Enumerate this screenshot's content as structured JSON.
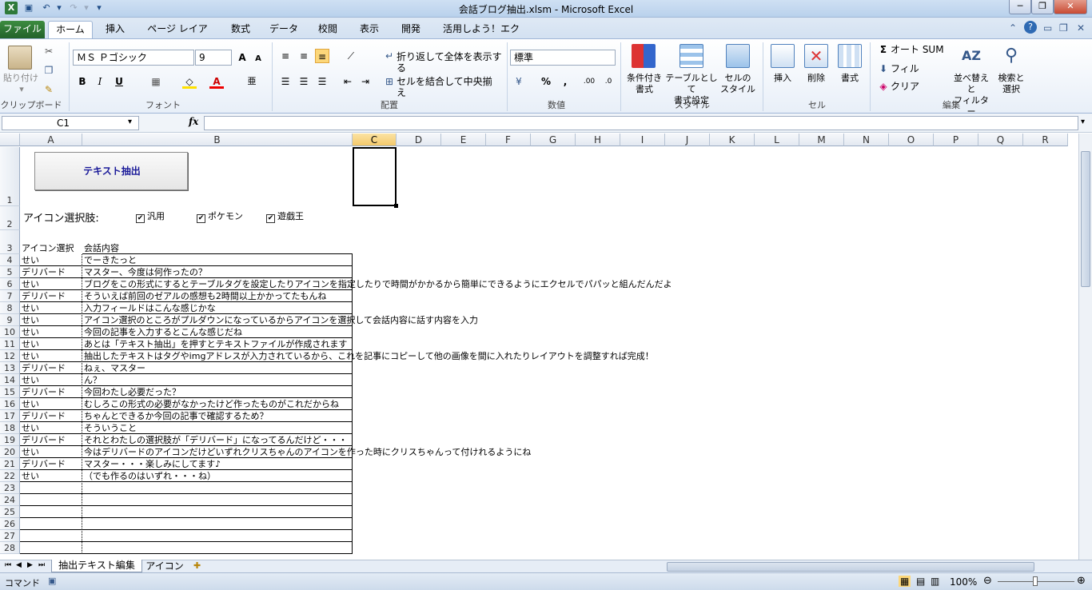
{
  "window": {
    "title": "会話ブログ抽出.xlsm - Microsoft Excel",
    "minimize": "─",
    "maximize": "❐",
    "close": "✕"
  },
  "quick_access": {
    "save_icon": "save-icon",
    "undo_icon": "undo-icon",
    "redo_icon": "redo-icon"
  },
  "tabs": [
    "ファイル",
    "ホーム",
    "挿入",
    "ページ レイアウト",
    "数式",
    "データ",
    "校閲",
    "表示",
    "開発",
    "活用しよう！エクセル"
  ],
  "ribbon": {
    "clipboard": {
      "paste": "貼り付け",
      "group": "クリップボード"
    },
    "font": {
      "name": "ＭＳ Ｐゴシック",
      "size": "9",
      "bold": "B",
      "italic": "I",
      "underline": "U",
      "group": "フォント",
      "grow": "A",
      "shrink": "A"
    },
    "alignment": {
      "wrap": "折り返して全体を表示する",
      "merge": "セルを結合して中央揃え",
      "group": "配置"
    },
    "number": {
      "format": "標準",
      "percent": "%",
      "comma": ",",
      "group": "数値"
    },
    "styles": {
      "conditional": "条件付き\n書式",
      "table": "テーブルとして\n書式設定",
      "cell": "セルの\nスタイル",
      "group": "スタイル"
    },
    "cells": {
      "insert": "挿入",
      "delete": "削除",
      "format": "書式",
      "group": "セル"
    },
    "editing": {
      "autosum": "オート SUM",
      "fill": "フィル",
      "clear": "クリア",
      "sort": "並べ替えと\nフィルター",
      "find": "検索と\n選択",
      "group": "編集"
    }
  },
  "formula_bar": {
    "namebox": "C1",
    "fx": "fx",
    "value": ""
  },
  "columns": [
    "A",
    "B",
    "C",
    "D",
    "E",
    "F",
    "G",
    "H",
    "I",
    "J",
    "K",
    "L",
    "M",
    "N",
    "O",
    "P",
    "Q",
    "R"
  ],
  "sheet": {
    "button": "テキスト抽出",
    "icon_label": "アイコン選択肢:",
    "checkboxes": [
      {
        "label": "汎用",
        "checked": true
      },
      {
        "label": "ポケモン",
        "checked": true
      },
      {
        "label": "遊戯王",
        "checked": true
      }
    ],
    "header_a": "アイコン選択",
    "header_b": "会話内容",
    "rows": [
      {
        "n": "4",
        "a": "せい",
        "b": "でーきたっと"
      },
      {
        "n": "5",
        "a": "デリバード",
        "b": "マスター、今度は何作ったの？"
      },
      {
        "n": "6",
        "a": "せい",
        "b": "ブログをこの形式にするとテーブルタグを設定したりアイコンを指定したりで時間がかかるから簡単にできるようにエクセルでパパッと組んだんだよ"
      },
      {
        "n": "7",
        "a": "デリバード",
        "b": "そういえば前回のゼアルの感想も2時間以上かかってたもんね"
      },
      {
        "n": "8",
        "a": "せい",
        "b": "入力フィールドはこんな感じかな"
      },
      {
        "n": "9",
        "a": "せい",
        "b": "アイコン選択のところがプルダウンになっているからアイコンを選択して会話内容に話す内容を入力"
      },
      {
        "n": "10",
        "a": "せい",
        "b": "今回の記事を入力するとこんな感じだね"
      },
      {
        "n": "11",
        "a": "せい",
        "b": "あとは「テキスト抽出」を押すとテキストファイルが作成されます"
      },
      {
        "n": "12",
        "a": "せい",
        "b": "抽出したテキストはタグやimgアドレスが入力されているから、これを記事にコピーして他の画像を間に入れたりレイアウトを調整すれば完成！"
      },
      {
        "n": "13",
        "a": "デリバード",
        "b": "ねぇ、マスター"
      },
      {
        "n": "14",
        "a": "せい",
        "b": "ん？"
      },
      {
        "n": "15",
        "a": "デリバード",
        "b": "今回わたし必要だった？"
      },
      {
        "n": "16",
        "a": "せい",
        "b": "むしろこの形式の必要がなかったけど作ったものがこれだからね"
      },
      {
        "n": "17",
        "a": "デリバード",
        "b": "ちゃんとできるか今回の記事で確認するため？"
      },
      {
        "n": "18",
        "a": "せい",
        "b": "そういうこと"
      },
      {
        "n": "19",
        "a": "デリバード",
        "b": "それとわたしの選択肢が「デリバード」になってるんだけど・・・"
      },
      {
        "n": "20",
        "a": "せい",
        "b": "今はデリバードのアイコンだけどいずれクリスちゃんのアイコンを作った時にクリスちゃんって付けれるようにね"
      },
      {
        "n": "21",
        "a": "デリバード",
        "b": "マスター・・・楽しみにしてます♪"
      },
      {
        "n": "22",
        "a": "せい",
        "b": "（でも作るのはいずれ・・・ね）"
      },
      {
        "n": "23",
        "a": "",
        "b": ""
      },
      {
        "n": "24",
        "a": "",
        "b": ""
      },
      {
        "n": "25",
        "a": "",
        "b": ""
      },
      {
        "n": "26",
        "a": "",
        "b": ""
      },
      {
        "n": "27",
        "a": "",
        "b": ""
      },
      {
        "n": "28",
        "a": "",
        "b": ""
      }
    ]
  },
  "sheet_tabs": [
    "抽出テキスト編集",
    "アイコン"
  ],
  "status": {
    "mode": "コマンド",
    "zoom": "100%"
  }
}
